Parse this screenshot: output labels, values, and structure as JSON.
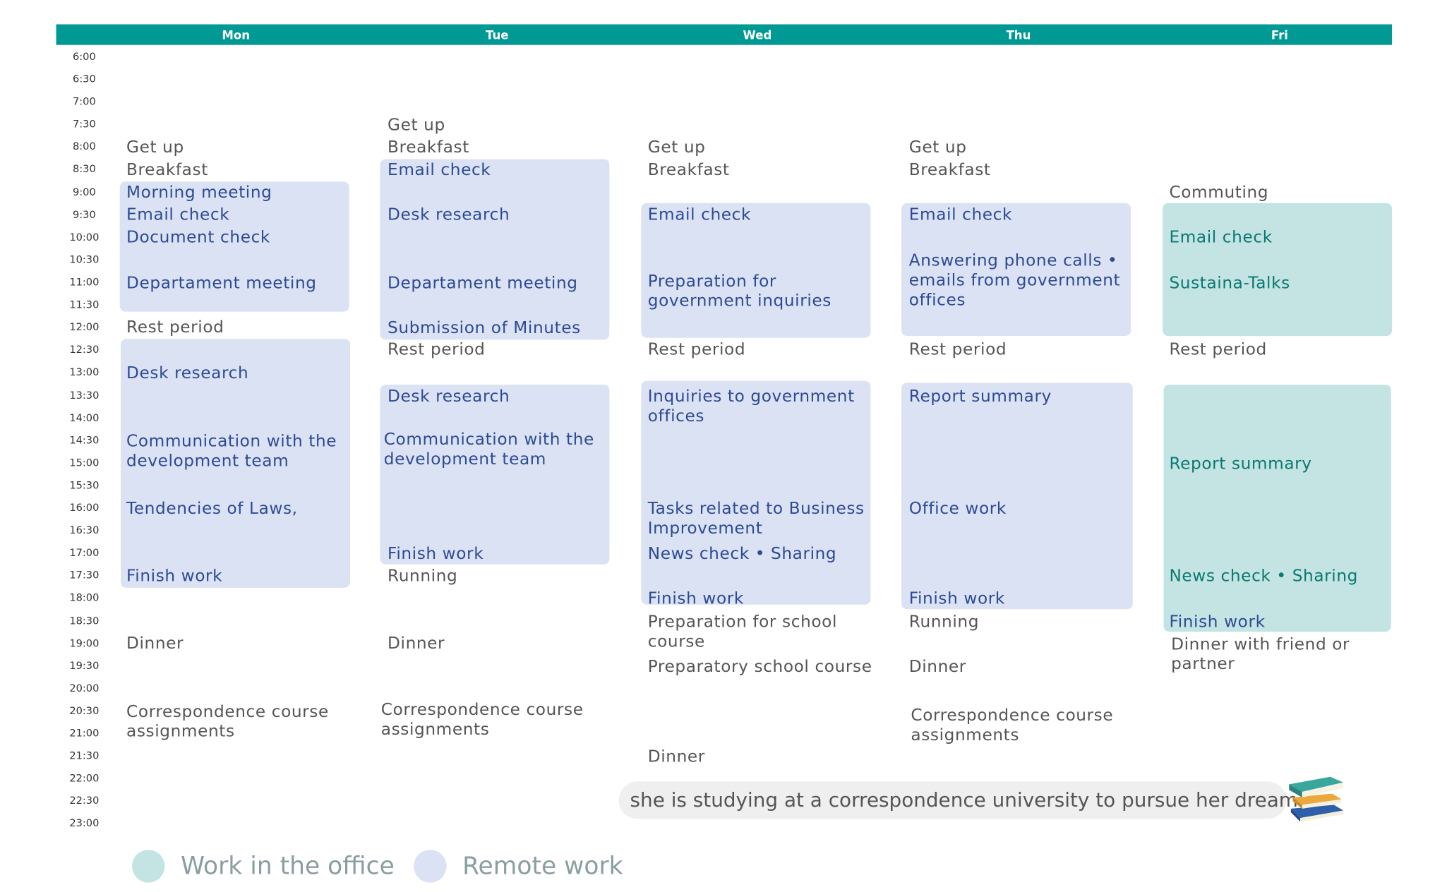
{
  "days": [
    "Mon",
    "Tue",
    "Wed",
    "Thu",
    "Fri"
  ],
  "times": [
    "6:00",
    "6:30",
    "7:00",
    "7:30",
    "8:00",
    "8:30",
    "9:00",
    "9:30",
    "10:00",
    "10:30",
    "11:00",
    "11:30",
    "12:00",
    "12:30",
    "13:00",
    "13:30",
    "14:00",
    "14:30",
    "15:00",
    "15:30",
    "16:00",
    "16:30",
    "17:00",
    "17:30",
    "18:00",
    "18:30",
    "19:00",
    "19:30",
    "20:00",
    "20:30",
    "21:00",
    "21:30",
    "22:00",
    "22:30",
    "23:00"
  ],
  "colors": {
    "header": "#009994",
    "remote": "#dae2f3",
    "office": "#c3e4e2",
    "remote_text": "#2e4a94",
    "office_text": "#0a7873",
    "plain_text": "#555555"
  },
  "mon": {
    "get_up": "Get up",
    "breakfast": "Breakfast",
    "morning_meeting": "Morning meeting",
    "email_check": "Email check",
    "document_check": "Document check",
    "dept_meeting": "Departament meeting",
    "rest": "Rest period",
    "desk_research": "Desk research",
    "comm_dev_1": "Communication with the",
    "comm_dev_2": "development team",
    "tendencies": "Tendencies of Laws,",
    "finish": "Finish work",
    "dinner": "Dinner",
    "corr_1": "Correspondence course",
    "corr_2": "assignments"
  },
  "tue": {
    "get_up": "Get up",
    "breakfast": "Breakfast",
    "email_check": "Email check",
    "desk_research_am": "Desk research",
    "dept_meeting": "Departament meeting",
    "minutes": "Submission of Minutes",
    "rest": "Rest period",
    "desk_research_pm": "Desk research",
    "comm_dev_1": "Communication with the",
    "comm_dev_2": "development team",
    "finish": "Finish work",
    "running": "Running",
    "dinner": "Dinner",
    "corr_1": "Correspondence course",
    "corr_2": "assignments"
  },
  "wed": {
    "get_up": "Get up",
    "breakfast": "Breakfast",
    "email_check": "Email check",
    "prep_1": "Preparation for",
    "prep_2": "government inquiries",
    "rest": "Rest period",
    "inq_1": "Inquiries to government",
    "inq_2": "offices",
    "tasks_1": "Tasks related to Business",
    "tasks_2": "Improvement",
    "news": "News check • Sharing",
    "finish": "Finish work",
    "prep_school_1": "Preparation for school",
    "prep_school_2": "course",
    "prep_school_course": "Preparatory school course",
    "dinner": "Dinner"
  },
  "thu": {
    "get_up": "Get up",
    "breakfast": "Breakfast",
    "email_check": "Email check",
    "calls_1": "Answering phone calls  •",
    "calls_2": "emails from government",
    "calls_3": "offices",
    "rest": "Rest period",
    "report": "Report summary",
    "office_work": "Office work",
    "finish": "Finish work",
    "running": "Running",
    "dinner": "Dinner",
    "corr_1": "Correspondence course",
    "corr_2": "assignments"
  },
  "fri": {
    "commuting": "Commuting",
    "email_check": "Email check",
    "sustaina": "Sustaina-Talks",
    "rest": "Rest period",
    "report": "Report summary",
    "news": "News check • Sharing",
    "finish": "Finish work",
    "dinner_1": "Dinner with friend or",
    "dinner_2": "partner"
  },
  "note": "she is studying at a correspondence university to pursue her dream",
  "legend": {
    "office": "Work in the office",
    "remote": "Remote work"
  }
}
